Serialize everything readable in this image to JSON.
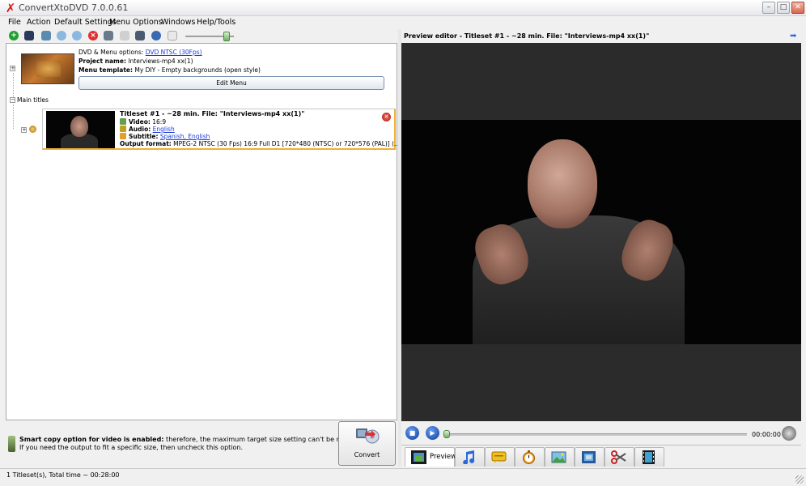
{
  "window": {
    "title": "ConvertXtoDVD 7.0.0.61",
    "controls": {
      "minimize": "–",
      "maximize": "□",
      "close": "✕"
    }
  },
  "menubar": {
    "items": [
      "File",
      "Action",
      "Default Settings",
      "Menu Options",
      "Windows",
      "Help/Tools"
    ]
  },
  "colors": {
    "accent": "#1a3ad8",
    "selection_border": "#f0b030",
    "preview_bg": "#2b2b2b"
  },
  "dvd_menu": {
    "options_label": "DVD & Menu options:",
    "options_value": "DVD NTSC (30Fps)",
    "project_label": "Project name:",
    "project_value": "Interviews-mp4 xx(1)",
    "template_label": "Menu template:",
    "template_value": "My  DIY - Empty backgrounds (open style)",
    "edit_button": "Edit Menu"
  },
  "tree": {
    "main_titles_label": "Main titles"
  },
  "titleset": {
    "title": "Titleset #1 - ~28 min. File: \"Interviews-mp4 xx(1)\"",
    "video_label": "Video:",
    "video_value": "16:9",
    "audio_label": "Audio:",
    "audio_value": "English",
    "subtitle_label": "Subtitle:",
    "subtitle_value": "Spanish, English",
    "output_label": "Output format:",
    "output_value": "MPEG-2 NTSC (30 Fps) 16:9 Full D1 [720*480 (NTSC) or 720*576 (PAL)] (..."
  },
  "smart_copy": {
    "bold_text": "Smart copy option for video is enabled:",
    "text1": " therefore, the maximum target size setting can't be respected...",
    "text2": "If you need the output to fit a specific size, then uncheck this option."
  },
  "convert": {
    "label": "Convert"
  },
  "status": {
    "text": "1 Titleset(s), Total time ~ 00:28:00"
  },
  "preview": {
    "title": "Preview editor - Titleset #1 - ~28 min. File: \"Interviews-mp4 xx(1)\"",
    "time": "00:00:00",
    "seek_fraction": 0.0
  },
  "editor_tabs": [
    {
      "icon": "film-preview-icon",
      "label": "Preview",
      "active": true
    },
    {
      "icon": "music-note-icon",
      "label": ""
    },
    {
      "icon": "subtitle-icon",
      "label": ""
    },
    {
      "icon": "stopwatch-icon",
      "label": ""
    },
    {
      "icon": "picture-edit-icon",
      "label": ""
    },
    {
      "icon": "aspect-crop-icon",
      "label": ""
    },
    {
      "icon": "scissors-icon",
      "label": ""
    },
    {
      "icon": "film-strip-icon",
      "label": ""
    }
  ]
}
